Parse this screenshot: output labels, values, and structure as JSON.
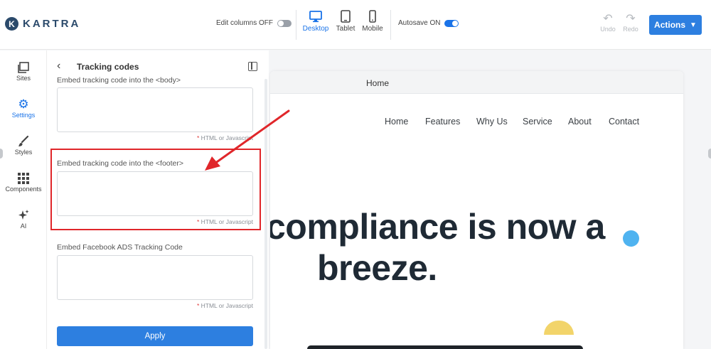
{
  "app": {
    "logo_letter": "K",
    "logo_text": "KARTRA"
  },
  "toolbar": {
    "edit_columns_label": "Edit columns OFF",
    "edit_columns_on": false,
    "devices": [
      {
        "label": "Desktop",
        "icon": "desktop-icon",
        "active": true
      },
      {
        "label": "Tablet",
        "icon": "tablet-icon",
        "active": false
      },
      {
        "label": "Mobile",
        "icon": "mobile-icon",
        "active": false
      }
    ],
    "autosave_label": "Autosave ON",
    "autosave_on": true,
    "undo_label": "Undo",
    "redo_label": "Redo",
    "actions_label": "Actions"
  },
  "rail": {
    "items": [
      {
        "label": "Sites",
        "icon": "sites-icon",
        "active": false
      },
      {
        "label": "Settings",
        "icon": "gear-icon",
        "active": true
      },
      {
        "label": "Styles",
        "icon": "brush-icon",
        "active": false
      },
      {
        "label": "Components",
        "icon": "grid-icon",
        "active": false
      },
      {
        "label": "AI",
        "icon": "sparkle-icon",
        "active": false
      }
    ]
  },
  "panel": {
    "title": "Tracking codes",
    "fields": [
      {
        "label": "Embed tracking code into the <body>",
        "value": "",
        "hint": "HTML or Javascript"
      },
      {
        "label": "Embed tracking code into the <footer>",
        "value": "",
        "hint": "HTML or Javascript"
      },
      {
        "label": "Embed Facebook ADS Tracking Code",
        "value": "",
        "hint": "HTML or Javascript"
      }
    ],
    "hint_star": "*",
    "apply_label": "Apply"
  },
  "preview": {
    "tab_label": "Home",
    "nav": [
      "Home",
      "Features",
      "Why Us",
      "Service",
      "About",
      "Contact"
    ],
    "hero_line1": "compliance is now a",
    "hero_line2": "breeze."
  },
  "colors": {
    "accent": "#2d7fe0",
    "highlight": "#e0262a",
    "hero_text": "#1f2a35"
  }
}
